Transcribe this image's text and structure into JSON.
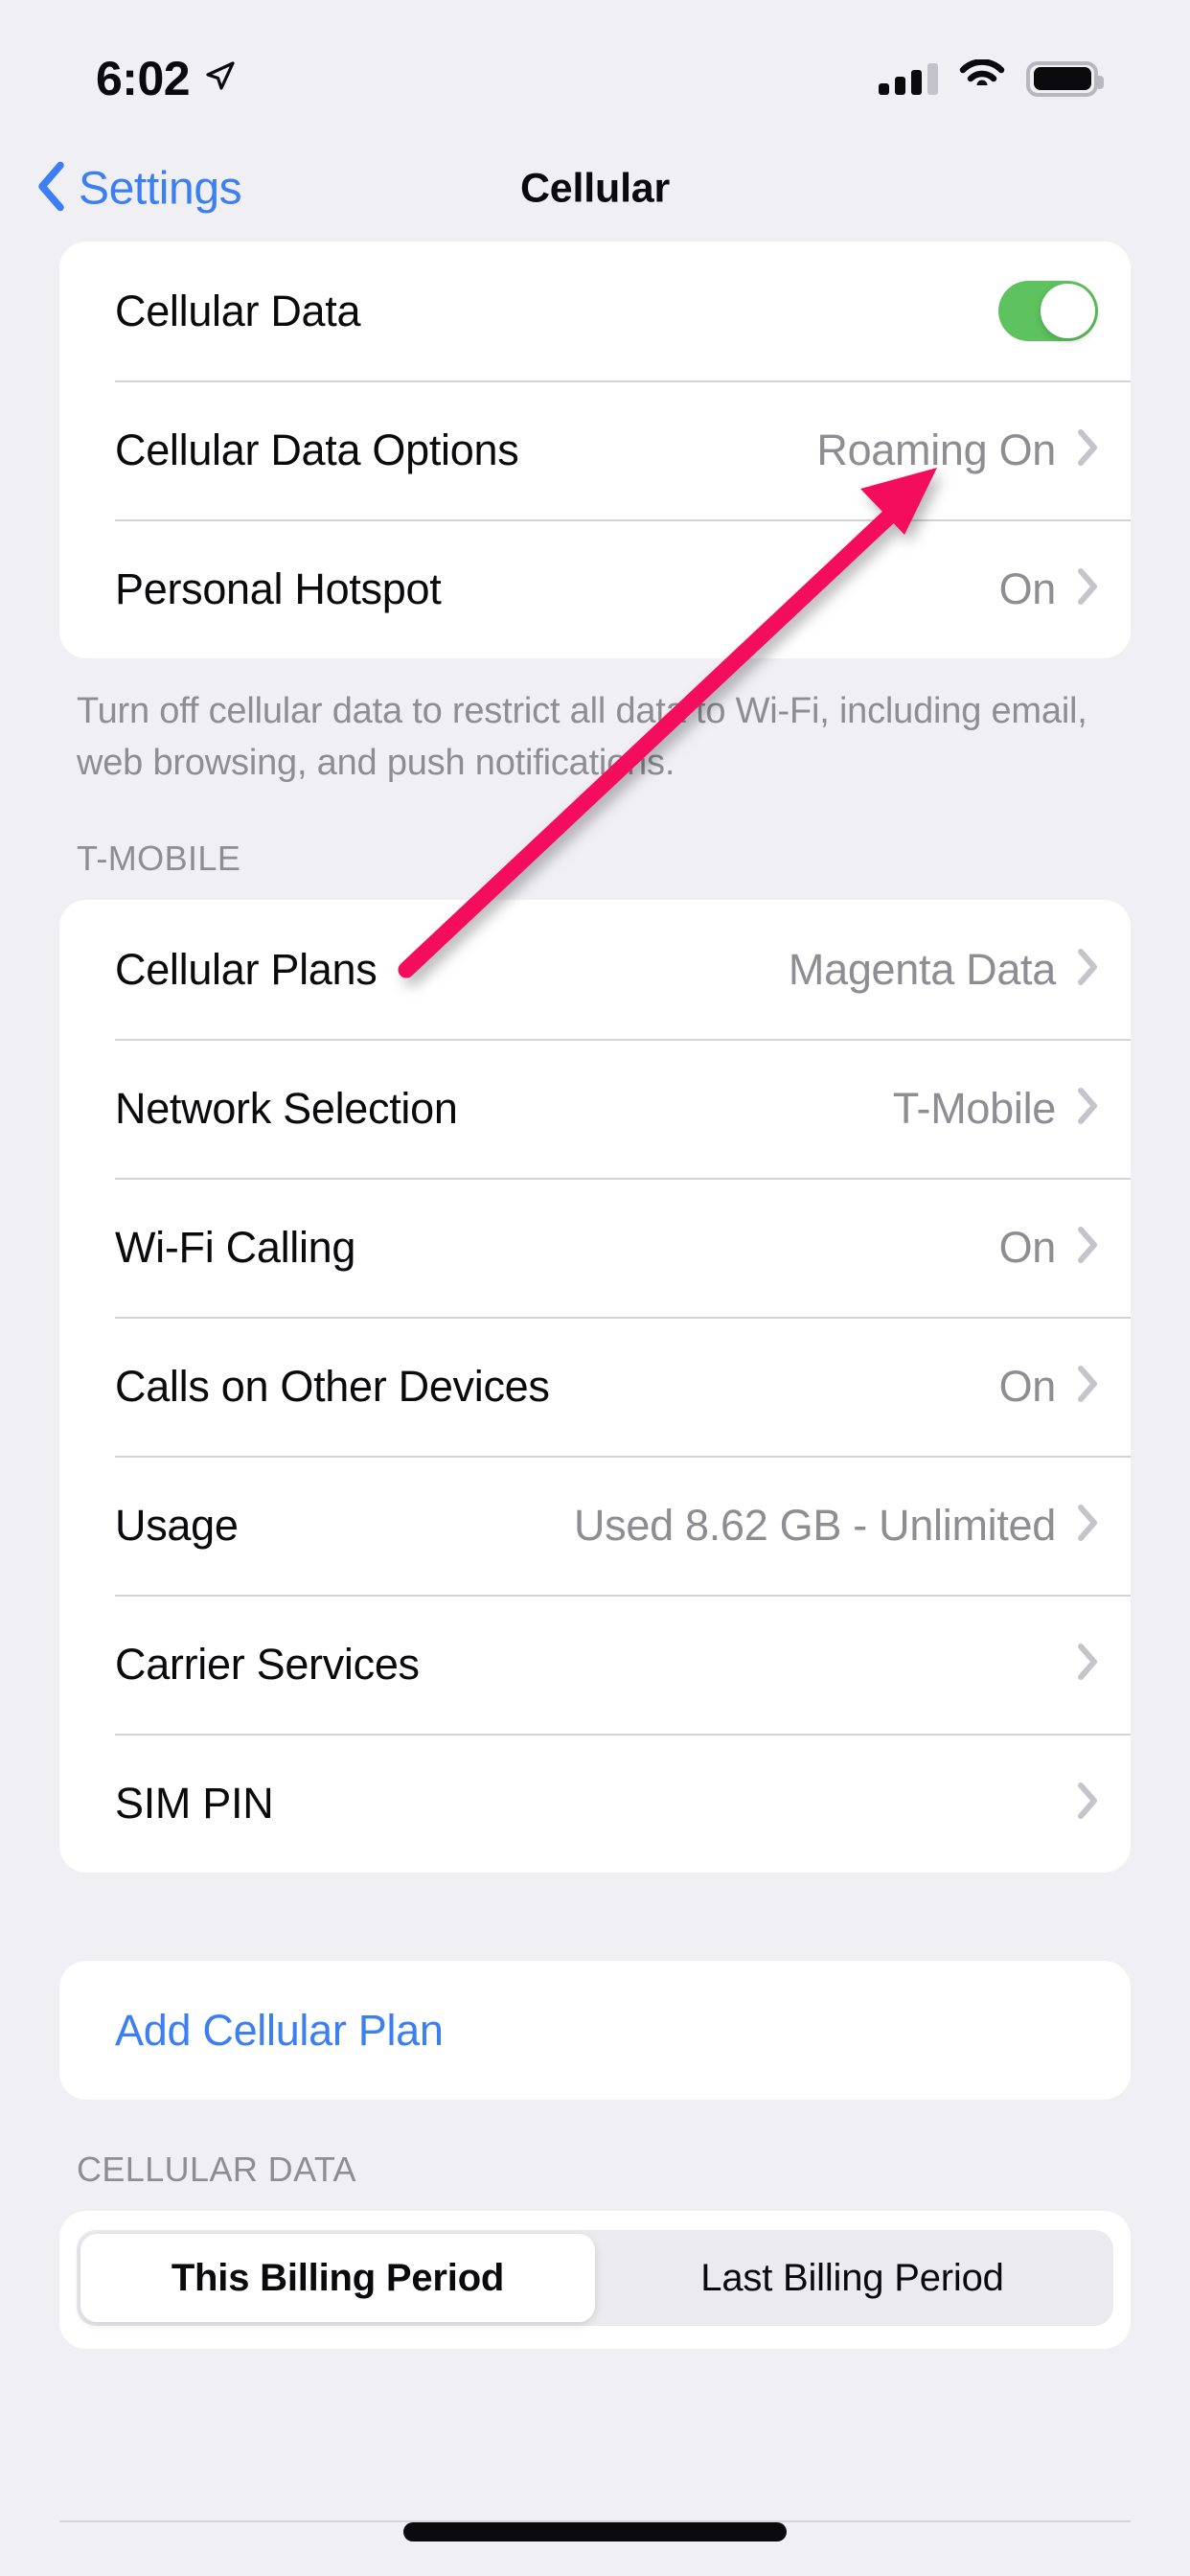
{
  "status_bar": {
    "time": "6:02",
    "location_icon": "location-arrow-icon",
    "signal_icon": "cellular-signal-icon",
    "signal_bars_filled": 3,
    "signal_bars_total": 4,
    "wifi_icon": "wifi-icon",
    "battery_icon": "battery-full-icon"
  },
  "nav": {
    "back_label": "Settings",
    "back_icon": "chevron-left-icon",
    "title": "Cellular"
  },
  "sections": {
    "data_card": {
      "rows": [
        {
          "label": "Cellular Data",
          "value": "",
          "control": "toggle",
          "toggle_on": true
        },
        {
          "label": "Cellular Data Options",
          "value": "Roaming On",
          "control": "chevron"
        },
        {
          "label": "Personal Hotspot",
          "value": "On",
          "control": "chevron"
        }
      ],
      "footer": "Turn off cellular data to restrict all data to Wi-Fi, including email, web browsing, and push notifications."
    },
    "carrier": {
      "header": "T-MOBILE",
      "rows": [
        {
          "label": "Cellular Plans",
          "value": "Magenta Data",
          "control": "chevron"
        },
        {
          "label": "Network Selection",
          "value": "T-Mobile",
          "control": "chevron"
        },
        {
          "label": "Wi-Fi Calling",
          "value": "On",
          "control": "chevron"
        },
        {
          "label": "Calls on Other Devices",
          "value": "On",
          "control": "chevron"
        },
        {
          "label": "Usage",
          "value": "Used 8.62 GB - Unlimited",
          "control": "chevron"
        },
        {
          "label": "Carrier Services",
          "value": "",
          "control": "chevron"
        },
        {
          "label": "SIM PIN",
          "value": "",
          "control": "chevron"
        }
      ]
    },
    "add_plan": {
      "label": "Add Cellular Plan"
    },
    "cellular_data_usage": {
      "header": "CELLULAR DATA",
      "segments": [
        {
          "label": "This Billing Period",
          "selected": true
        },
        {
          "label": "Last Billing Period",
          "selected": false
        }
      ]
    }
  },
  "annotation": {
    "type": "arrow",
    "color": "#F4115C",
    "points_to": "cellular-data-toggle"
  },
  "colors": {
    "background": "#F0EFF4",
    "card": "#FFFFFF",
    "accent_blue": "#3C7EF4",
    "toggle_green": "#5EC25E",
    "secondary_text": "#8D8D93",
    "separator": "#D3D2D7",
    "chevron": "#C5C4CA"
  }
}
